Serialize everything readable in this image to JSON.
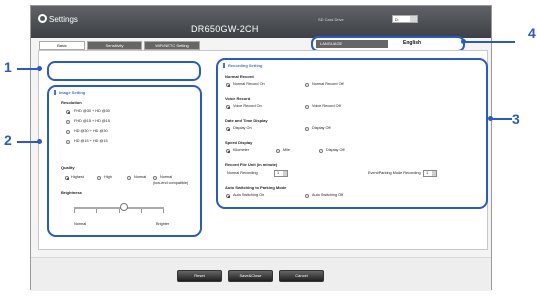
{
  "app": {
    "title": "Settings",
    "model": "DR650GW-2CH",
    "sd_card_label": "SD Card Drive",
    "sd_card_value": "D:",
    "language_label": "LANGUAGE",
    "language_value": "English"
  },
  "tabs": [
    {
      "label": "Basic"
    },
    {
      "label": "Sensitivity"
    },
    {
      "label": "WiFi/NETC Setting"
    }
  ],
  "image_setting": {
    "title": "Image Setting",
    "resolution_label": "Resolution",
    "resolution_options": [
      "FHD @30 + HD @30",
      "FHD @15 + HD @15",
      "HD @30 + HD @30",
      "HD @15 + HD @15"
    ],
    "quality_label": "Quality",
    "quality_options": [
      "Highest",
      "High",
      "Normal",
      "Normal"
    ],
    "quality_note": "(low-end compatible)",
    "brightness_label": "Brightness",
    "brightness_min": "Normal",
    "brightness_max": "Brighter",
    "brightness_level": 0.55
  },
  "recording_setting": {
    "title": "Recording Setting",
    "normal_record_label": "Normal Record",
    "normal_record_on": "Normal Record On",
    "normal_record_off": "Normal Record Off",
    "voice_record_label": "Voice Record",
    "voice_record_on": "Voice Record On",
    "voice_record_off": "Voice Record Off",
    "date_time_label": "Date and Time Display",
    "display_on": "Display On",
    "display_off": "Display Off",
    "speed_label": "Speed Display",
    "kilometer": "Kilometer",
    "mile": "Mile",
    "speed_display_off": "Display Off",
    "record_unit_label": "Record File Unit (in minute)",
    "normal_recording": "Normal Recording",
    "normal_recording_value": "1",
    "event_recording": "Event/Parking Mode Recording",
    "event_recording_value": "1",
    "auto_switch_label": "Auto Switching to Parking Mode",
    "auto_switch_on": "Auto Switching On",
    "auto_switch_off": "Auto Switching Off"
  },
  "buttons": {
    "reset": "Reset",
    "save_close": "Save&Close",
    "cancel": "Cancel"
  },
  "callouts": [
    "1",
    "2",
    "3",
    "4"
  ],
  "colors": {
    "callout": "#2b5bbd",
    "header_bg": "#4d5054",
    "section_title": "#4b74c4"
  },
  "icons": {
    "settings": "gear-icon"
  }
}
